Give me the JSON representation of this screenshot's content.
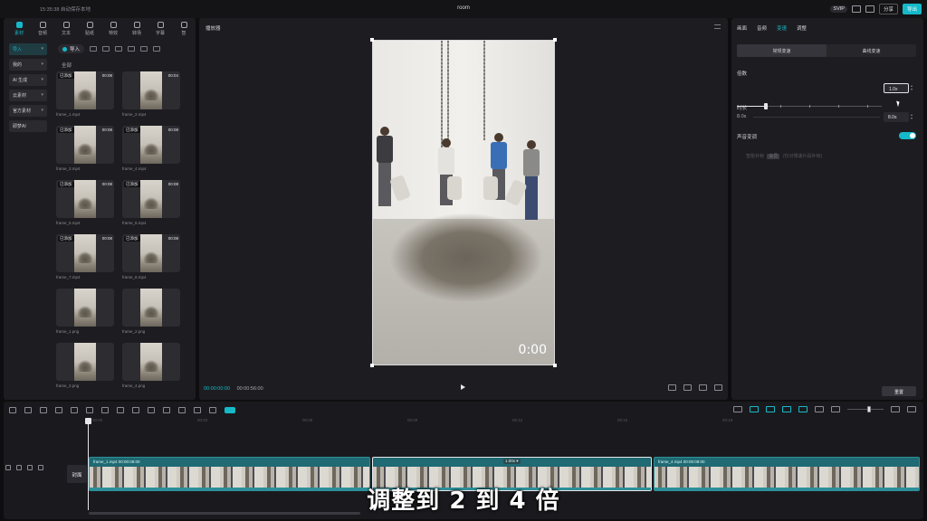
{
  "window": {
    "title": "room",
    "status": "15:35:38 自动保存本地"
  },
  "topbar": {
    "svip": "SVIP",
    "share": "分享",
    "export": "导出"
  },
  "left_panel": {
    "tools": [
      "素材",
      "音频",
      "文本",
      "贴纸",
      "特效",
      "转场",
      "字幕",
      "智"
    ],
    "categories": [
      {
        "label": "导入"
      },
      {
        "label": "我的"
      },
      {
        "label": "AI 生成"
      },
      {
        "label": "云素材"
      },
      {
        "label": "官方素材"
      },
      {
        "label": "即梦AI"
      }
    ],
    "import_label": "导入",
    "all_label": "全部",
    "media": [
      {
        "name": "frame_1.mp4",
        "duration": "00:08",
        "added": "已添加"
      },
      {
        "name": "frame_2.mp4",
        "duration": "00:04",
        "added": ""
      },
      {
        "name": "frame_3.mp4",
        "duration": "00:08",
        "added": "已添加"
      },
      {
        "name": "frame_4.mp4",
        "duration": "00:08",
        "added": "已添加"
      },
      {
        "name": "frame_5.mp4",
        "duration": "00:08",
        "added": "已添加"
      },
      {
        "name": "frame_6.mp4",
        "duration": "00:08",
        "added": "已添加"
      },
      {
        "name": "frame_7.mp4",
        "duration": "00:08",
        "added": "已添加"
      },
      {
        "name": "frame_8.mp4",
        "duration": "00:08",
        "added": "已添加"
      },
      {
        "name": "frame_1.png",
        "duration": "",
        "added": ""
      },
      {
        "name": "frame_2.png",
        "duration": "",
        "added": ""
      },
      {
        "name": "frame_3.png",
        "duration": "",
        "added": ""
      },
      {
        "name": "frame_4.png",
        "duration": "",
        "added": ""
      },
      {
        "name": "",
        "duration": "",
        "added": ""
      },
      {
        "name": "",
        "duration": "",
        "added": ""
      }
    ]
  },
  "player": {
    "title": "播放器",
    "overlay_time": "0:00",
    "current_time": "00:00:00:00",
    "total_time": "00:00:56:00"
  },
  "right_panel": {
    "tabs": [
      "画面",
      "音频",
      "变速",
      "调整"
    ],
    "active_tab": "变速",
    "segments": [
      "常规变速",
      "曲线变速"
    ],
    "multiplier_label": "倍数",
    "multiplier_value": "1.0x",
    "speed_fraction": 0.2,
    "duration_label": "时长",
    "duration_from": "8.0s",
    "duration_to": "8.0s",
    "pitch_label": "声音变调",
    "smooth_label": "智能补帧",
    "smooth_badge": "会员",
    "smooth_hint": "(仅对慢速片段补帧)",
    "reset": "重置"
  },
  "timeline": {
    "ai_badge": "AI",
    "ruler": [
      "00:00",
      "00:03",
      "00:06",
      "00:09",
      "00:12",
      "00:15",
      "00:18"
    ],
    "cover": "封面",
    "clips": [
      {
        "label": "frame_1.mp4  00:00:08:00",
        "speed": ""
      },
      {
        "label": "",
        "speed": "1.00x ▾"
      },
      {
        "label": "frame_4.mp4  00:00:08:00",
        "speed": ""
      }
    ]
  },
  "subtitle": "调整到 2 到 4 倍",
  "colors": {
    "accent": "#16b9c9",
    "panel": "#1d1d21",
    "background": "#0e0e10"
  }
}
